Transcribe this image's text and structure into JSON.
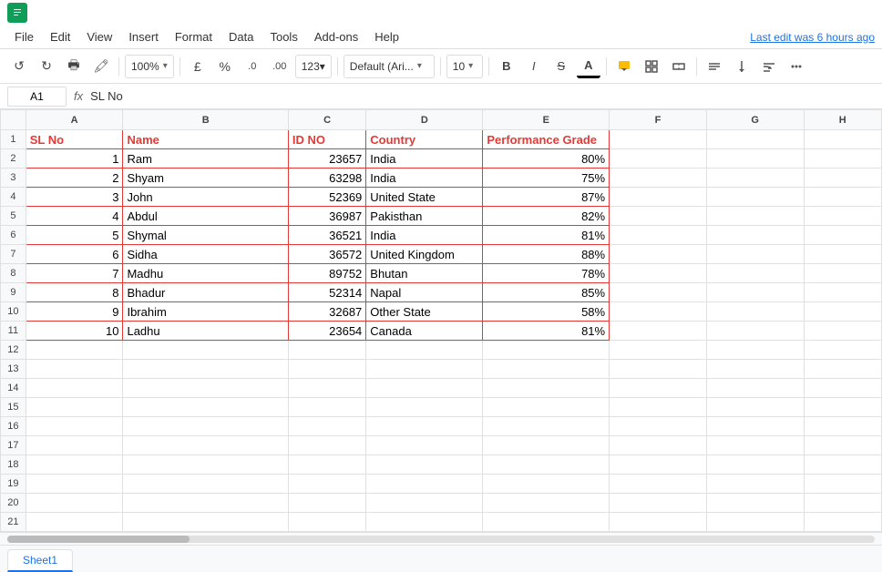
{
  "app": {
    "icon_text": "S",
    "last_edit": "Last edit was 6 hours ago"
  },
  "menu": {
    "items": [
      "File",
      "Edit",
      "View",
      "Insert",
      "Format",
      "Data",
      "Tools",
      "Add-ons",
      "Help"
    ]
  },
  "toolbar": {
    "zoom": "100%",
    "currency": "£",
    "percent": "%",
    "decimal0": ".0",
    "decimal00": ".00",
    "format123": "123▾",
    "font": "Default (Ari...",
    "font_size": "10",
    "bold": "B",
    "italic": "I",
    "strikethrough": "S",
    "underline": "A"
  },
  "formula_bar": {
    "cell_ref": "A1",
    "fx": "fx",
    "content": "SL No"
  },
  "columns": {
    "headers": [
      "",
      "A",
      "B",
      "C",
      "D",
      "E",
      "F",
      "G",
      "H"
    ]
  },
  "rows": [
    {
      "num": "1",
      "A": "SL No",
      "B": "Name",
      "C": "ID NO",
      "D": "Country",
      "E": "Performance Grade",
      "is_header": true
    },
    {
      "num": "2",
      "A": "1",
      "B": "Ram",
      "C": "23657",
      "D": "India",
      "E": "80%"
    },
    {
      "num": "3",
      "A": "2",
      "B": "Shyam",
      "C": "63298",
      "D": "India",
      "E": "75%"
    },
    {
      "num": "4",
      "A": "3",
      "B": "John",
      "C": "52369",
      "D": "United State",
      "E": "87%"
    },
    {
      "num": "5",
      "A": "4",
      "B": "Abdul",
      "C": "36987",
      "D": "Pakisthan",
      "E": "82%"
    },
    {
      "num": "6",
      "A": "5",
      "B": "Shymal",
      "C": "36521",
      "D": "India",
      "E": "81%"
    },
    {
      "num": "7",
      "A": "6",
      "B": "Sidha",
      "C": "36572",
      "D": "United Kingdom",
      "E": "88%"
    },
    {
      "num": "8",
      "A": "7",
      "B": "Madhu",
      "C": "89752",
      "D": "Bhutan",
      "E": "78%"
    },
    {
      "num": "9",
      "A": "8",
      "B": "Bhadur",
      "C": "52314",
      "D": "Napal",
      "E": "85%"
    },
    {
      "num": "10",
      "A": "9",
      "B": "Ibrahim",
      "C": "32687",
      "D": "Other State",
      "E": "58%"
    },
    {
      "num": "11",
      "A": "10",
      "B": "Ladhu",
      "C": "23654",
      "D": "Canada",
      "E": "81%"
    }
  ],
  "empty_rows": [
    "12",
    "13",
    "14",
    "15",
    "16",
    "17",
    "18",
    "19",
    "20",
    "21"
  ],
  "sheet_tabs": [
    "Sheet1"
  ]
}
